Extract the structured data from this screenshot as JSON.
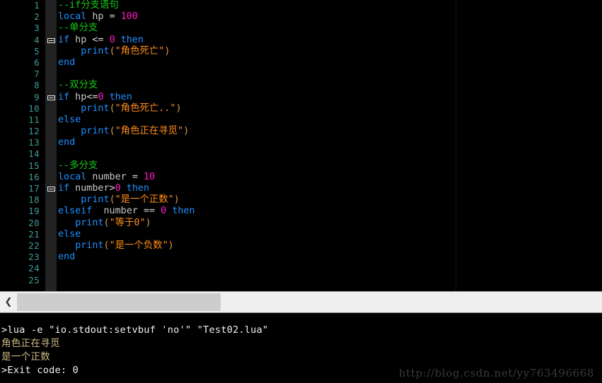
{
  "editor": {
    "name": "lua-source-editor",
    "language": "Lua",
    "total_lines": 25,
    "first_visible_line": 1,
    "colors": {
      "background": "#000000",
      "gutter_text": "#3f9a9a",
      "fold_column": "#222222",
      "comment": "#16ca16",
      "keyword": "#1e90ff",
      "number": "#ff1cc4",
      "string": "#ff8c1a",
      "identifier": "#c8c8c8",
      "paren": "#d99a4e"
    },
    "lines": [
      {
        "num": "1",
        "fold": false,
        "tokens": [
          {
            "t": "--if分支语句",
            "c": "tok-comment"
          }
        ]
      },
      {
        "num": "2",
        "fold": false,
        "tokens": [
          {
            "t": "local",
            "c": "tok-keyword"
          },
          {
            "t": " hp ",
            "c": "tok-ident"
          },
          {
            "t": "= ",
            "c": "tok-op"
          },
          {
            "t": "100",
            "c": "tok-number"
          }
        ]
      },
      {
        "num": "3",
        "fold": false,
        "tokens": [
          {
            "t": "--单分支",
            "c": "tok-comment"
          }
        ]
      },
      {
        "num": "4",
        "fold": true,
        "tokens": [
          {
            "t": "if",
            "c": "tok-keyword"
          },
          {
            "t": " hp ",
            "c": "tok-ident"
          },
          {
            "t": "<= ",
            "c": "tok-op"
          },
          {
            "t": "0",
            "c": "tok-number"
          },
          {
            "t": " ",
            "c": "tok-plain"
          },
          {
            "t": "then",
            "c": "tok-keyword"
          }
        ]
      },
      {
        "num": "5",
        "fold": false,
        "tokens": [
          {
            "t": "    ",
            "c": "tok-plain"
          },
          {
            "t": "print",
            "c": "tok-func"
          },
          {
            "t": "(",
            "c": "tok-paren"
          },
          {
            "t": "\"角色死亡\"",
            "c": "tok-string"
          },
          {
            "t": ")",
            "c": "tok-paren"
          }
        ]
      },
      {
        "num": "6",
        "fold": false,
        "tokens": [
          {
            "t": "end",
            "c": "tok-keyword"
          }
        ]
      },
      {
        "num": "7",
        "fold": false,
        "tokens": []
      },
      {
        "num": "8",
        "fold": false,
        "tokens": [
          {
            "t": "--双分支",
            "c": "tok-comment"
          }
        ]
      },
      {
        "num": "9",
        "fold": true,
        "tokens": [
          {
            "t": "if",
            "c": "tok-keyword"
          },
          {
            "t": " hp",
            "c": "tok-ident"
          },
          {
            "t": "<=",
            "c": "tok-op"
          },
          {
            "t": "0",
            "c": "tok-number"
          },
          {
            "t": " ",
            "c": "tok-plain"
          },
          {
            "t": "then",
            "c": "tok-keyword"
          }
        ]
      },
      {
        "num": "10",
        "fold": false,
        "tokens": [
          {
            "t": "    ",
            "c": "tok-plain"
          },
          {
            "t": "print",
            "c": "tok-func"
          },
          {
            "t": "(",
            "c": "tok-paren"
          },
          {
            "t": "\"角色死亡..\"",
            "c": "tok-string"
          },
          {
            "t": ")",
            "c": "tok-paren"
          }
        ]
      },
      {
        "num": "11",
        "fold": false,
        "tokens": [
          {
            "t": "else",
            "c": "tok-keyword"
          }
        ]
      },
      {
        "num": "12",
        "fold": false,
        "tokens": [
          {
            "t": "    ",
            "c": "tok-plain"
          },
          {
            "t": "print",
            "c": "tok-func"
          },
          {
            "t": "(",
            "c": "tok-paren"
          },
          {
            "t": "\"角色正在寻觅\"",
            "c": "tok-string"
          },
          {
            "t": ")",
            "c": "tok-paren"
          }
        ]
      },
      {
        "num": "13",
        "fold": false,
        "tokens": [
          {
            "t": "end",
            "c": "tok-keyword"
          }
        ]
      },
      {
        "num": "14",
        "fold": false,
        "tokens": []
      },
      {
        "num": "15",
        "fold": false,
        "tokens": [
          {
            "t": "--多分支",
            "c": "tok-comment"
          }
        ]
      },
      {
        "num": "16",
        "fold": false,
        "tokens": [
          {
            "t": "local",
            "c": "tok-keyword"
          },
          {
            "t": " number ",
            "c": "tok-ident"
          },
          {
            "t": "= ",
            "c": "tok-op"
          },
          {
            "t": "10",
            "c": "tok-number"
          }
        ]
      },
      {
        "num": "17",
        "fold": true,
        "tokens": [
          {
            "t": "if",
            "c": "tok-keyword"
          },
          {
            "t": " number",
            "c": "tok-ident"
          },
          {
            "t": ">",
            "c": "tok-op"
          },
          {
            "t": "0",
            "c": "tok-number"
          },
          {
            "t": " ",
            "c": "tok-plain"
          },
          {
            "t": "then",
            "c": "tok-keyword"
          }
        ]
      },
      {
        "num": "18",
        "fold": false,
        "tokens": [
          {
            "t": "    ",
            "c": "tok-plain"
          },
          {
            "t": "print",
            "c": "tok-func"
          },
          {
            "t": "(",
            "c": "tok-paren"
          },
          {
            "t": "\"是一个正数\"",
            "c": "tok-string"
          },
          {
            "t": ")",
            "c": "tok-paren"
          }
        ]
      },
      {
        "num": "19",
        "fold": false,
        "tokens": [
          {
            "t": "elseif",
            "c": "tok-keyword"
          },
          {
            "t": "  number ",
            "c": "tok-ident"
          },
          {
            "t": "== ",
            "c": "tok-op"
          },
          {
            "t": "0",
            "c": "tok-number"
          },
          {
            "t": " ",
            "c": "tok-plain"
          },
          {
            "t": "then",
            "c": "tok-keyword"
          }
        ]
      },
      {
        "num": "20",
        "fold": false,
        "tokens": [
          {
            "t": "   ",
            "c": "tok-plain"
          },
          {
            "t": "print",
            "c": "tok-func"
          },
          {
            "t": "(",
            "c": "tok-paren"
          },
          {
            "t": "\"等于0\"",
            "c": "tok-string"
          },
          {
            "t": ")",
            "c": "tok-paren"
          }
        ]
      },
      {
        "num": "21",
        "fold": false,
        "tokens": [
          {
            "t": "else",
            "c": "tok-keyword"
          }
        ]
      },
      {
        "num": "22",
        "fold": false,
        "tokens": [
          {
            "t": "   ",
            "c": "tok-plain"
          },
          {
            "t": "print",
            "c": "tok-func"
          },
          {
            "t": "(",
            "c": "tok-paren"
          },
          {
            "t": "\"是一个负数\"",
            "c": "tok-string"
          },
          {
            "t": ")",
            "c": "tok-paren"
          }
        ]
      },
      {
        "num": "23",
        "fold": false,
        "tokens": [
          {
            "t": "end",
            "c": "tok-keyword"
          }
        ]
      },
      {
        "num": "24",
        "fold": false,
        "tokens": []
      },
      {
        "num": "25",
        "fold": false,
        "tokens": []
      }
    ]
  },
  "scrollbar": {
    "left_arrow_glyph": "❮",
    "orientation": "horizontal"
  },
  "console": {
    "lines": [
      {
        "text": ">lua -e \"io.stdout:setvbuf 'no'\" \"Test02.lua\"",
        "kind": "cmd"
      },
      {
        "text": "角色正在寻觅",
        "kind": "out"
      },
      {
        "text": "是一个正数",
        "kind": "out"
      },
      {
        "text": ">Exit code: 0",
        "kind": "exit"
      }
    ]
  },
  "watermark": {
    "text": "http://blog.csdn.net/yy763496668"
  }
}
